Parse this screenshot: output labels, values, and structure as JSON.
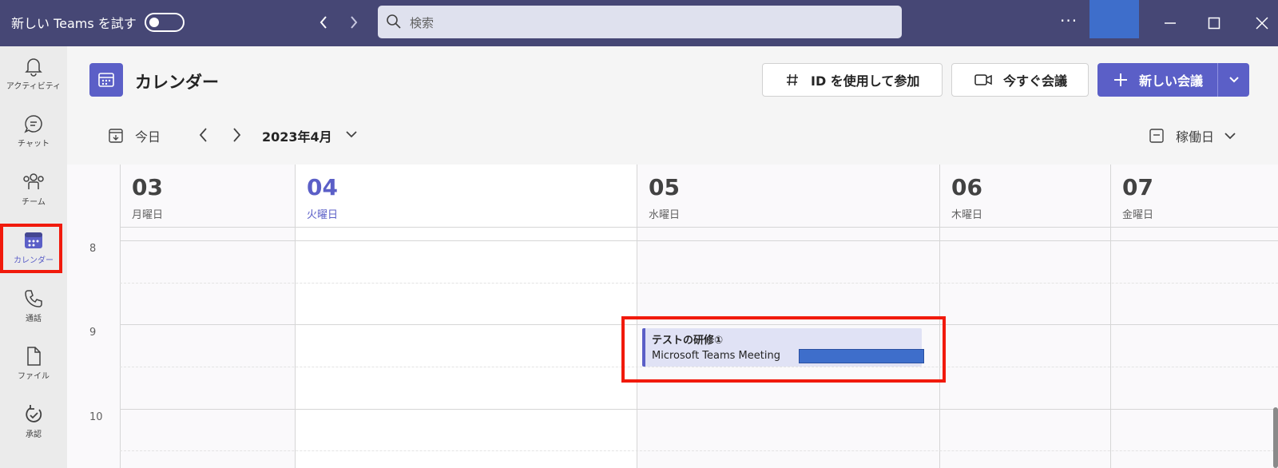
{
  "titlebar": {
    "new_teams_label": "新しい Teams を試す",
    "search_placeholder": "検索",
    "more": "···"
  },
  "rail": {
    "items": [
      {
        "label": "アクティビティ",
        "icon": "bell-icon"
      },
      {
        "label": "チャット",
        "icon": "chat-icon"
      },
      {
        "label": "チーム",
        "icon": "teams-icon"
      },
      {
        "label": "カレンダー",
        "icon": "calendar-icon"
      },
      {
        "label": "通話",
        "icon": "phone-icon"
      },
      {
        "label": "ファイル",
        "icon": "file-icon"
      },
      {
        "label": "承認",
        "icon": "approvals-icon"
      }
    ]
  },
  "header": {
    "title": "カレンダー",
    "join_with_id": "ID を使用して参加",
    "meet_now": "今すぐ会議",
    "new_meeting": "新しい会議",
    "today": "今日",
    "month": "2023年4月",
    "view": "稼働日"
  },
  "days": [
    {
      "num": "03",
      "name": "月曜日"
    },
    {
      "num": "04",
      "name": "火曜日",
      "today": true
    },
    {
      "num": "05",
      "name": "水曜日"
    },
    {
      "num": "06",
      "name": "木曜日"
    },
    {
      "num": "07",
      "name": "金曜日"
    }
  ],
  "hours": [
    "8",
    "9",
    "10"
  ],
  "event": {
    "title": "テストの研修",
    "title_badge": "①",
    "subtitle": "Microsoft Teams Meeting"
  },
  "colors": {
    "accent": "#5b5fc7",
    "titlebar": "#464775",
    "highlight": "#f11a0c"
  }
}
